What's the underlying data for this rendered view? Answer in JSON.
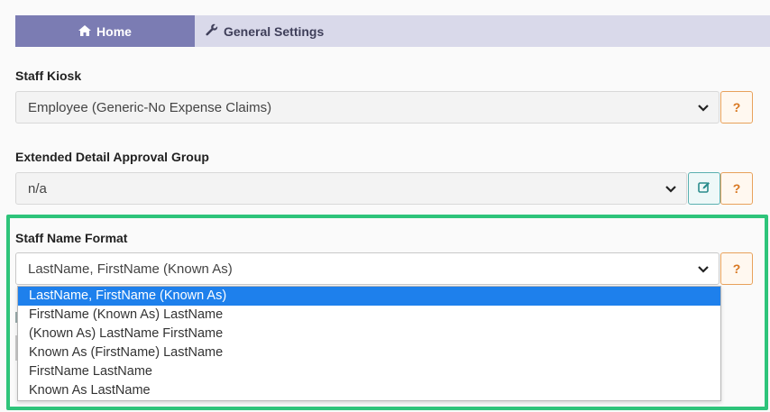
{
  "tabs": {
    "home_label": "Home",
    "home_icon": "home-icon",
    "general_label": "General Settings",
    "general_icon": "wrench-icon"
  },
  "staff_kiosk": {
    "label": "Staff Kiosk",
    "value": "Employee (Generic-No Expense Claims)",
    "help_label": "?"
  },
  "approval_group": {
    "label": "Extended Detail Approval Group",
    "value": "n/a",
    "edit_icon": "edit-icon",
    "help_label": "?"
  },
  "name_format": {
    "label": "Staff Name Format",
    "value": "LastName, FirstName (Known As)",
    "help_label": "?",
    "options": [
      "LastName, FirstName (Known As)",
      "FirstName (Known As) LastName",
      "(Known As) LastName FirstName",
      "Known As (FirstName) LastName",
      "FirstName LastName",
      "Known As LastName"
    ],
    "selected_index": 0
  },
  "colors": {
    "tab_active": "#7b7cb3",
    "tab_bar": "#d9d9ea",
    "highlight": "#2ec47a",
    "help": "#d8761f",
    "edit": "#2a8c8c",
    "option_selected": "#1e80ec"
  }
}
